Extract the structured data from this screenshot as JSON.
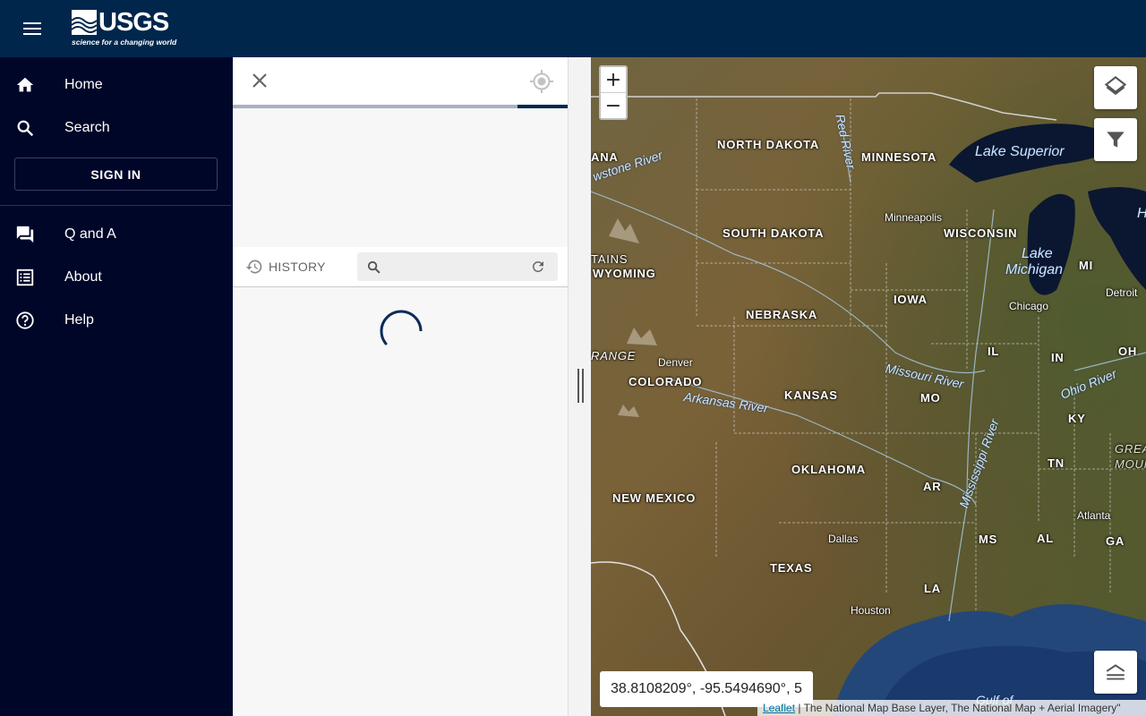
{
  "header": {
    "logo_word": "USGS",
    "logo_tagline": "science for a changing world",
    "menu_icon": "menu-icon"
  },
  "sidebar": {
    "items": [
      {
        "label": "Home",
        "icon": "home-icon"
      },
      {
        "label": "Search",
        "icon": "search-icon"
      },
      {
        "label": "Q and A",
        "icon": "forum-icon"
      },
      {
        "label": "About",
        "icon": "list-icon"
      },
      {
        "label": "Help",
        "icon": "help-icon"
      }
    ],
    "sign_in_label": "SIGN IN"
  },
  "panel": {
    "progress_fraction": 0.15,
    "history_label": "HISTORY",
    "search_placeholder": "",
    "search_value": ""
  },
  "map": {
    "coordinates": "38.8108209°, -95.5494690°, 5",
    "attribution_link": "Leaflet",
    "attribution_text": " | The National Map Base Layer, The National Map + Aerial Imagery\"",
    "zoom_in": "+",
    "zoom_out": "−",
    "labels": {
      "ana": "ANA",
      "north_dakota": "NORTH DAKOTA",
      "minnesota": "MINNESOTA",
      "south_dakota": "SOUTH DAKOTA",
      "wisconsin": "WISCONSIN",
      "tains": "TAINS",
      "wyoming": "WYOMING",
      "iowa": "IOWA",
      "mi": "MI",
      "nebraska": "NEBRASKA",
      "range": "RANGE",
      "colorado": "COLORADO",
      "kansas": "KANSAS",
      "il": "IL",
      "in": "IN",
      "oh": "OH",
      "mo": "MO",
      "ky": "KY",
      "oklahoma": "OKLAHOMA",
      "tn": "TN",
      "new_mexico": "NEW MEXICO",
      "ar": "AR",
      "ms": "MS",
      "al": "AL",
      "ga": "GA",
      "texas": "TEXAS",
      "la": "LA",
      "great": "GREAT",
      "moun": "MOUN",
      "h": "H"
    },
    "cities": {
      "minneapolis": "Minneapolis",
      "chicago": "Chicago",
      "detroit": "Detroit",
      "denver": "Denver",
      "dallas": "Dallas",
      "atlanta": "Atlanta",
      "houston": "Houston"
    },
    "waters": {
      "lake_superior": "Lake Superior",
      "lake": "Lake",
      "michigan": "Michigan",
      "gulf_of": "Gulf of"
    },
    "rivers": {
      "yellowstone": "wstone River",
      "red": "Red River",
      "missouri": "Missouri River",
      "arkansas": "Arkansas River",
      "ohio": "Ohio River",
      "mississippi": "Mississippi River"
    }
  }
}
